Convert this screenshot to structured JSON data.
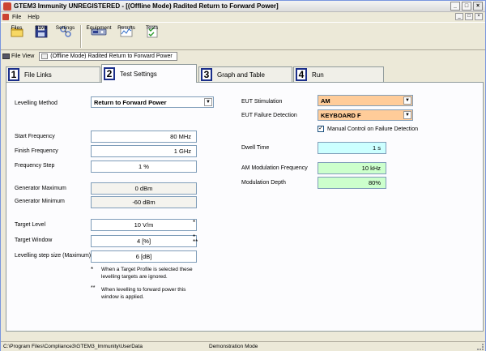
{
  "window": {
    "title": "GTEM3 Immunity UNREGISTERED - [(Offline Mode) Radited Return to Forward Power]",
    "buttons": [
      "_",
      "□",
      "×"
    ]
  },
  "menu": {
    "items": [
      {
        "label": "File"
      },
      {
        "label": "Help"
      }
    ]
  },
  "toolbar": {
    "files": "Files",
    "save": "Save",
    "settings": "Settings",
    "equipment": "Equipment",
    "results": "Results",
    "tests": "Tests"
  },
  "docbar": {
    "file_view": "File View",
    "doc_tab": "(Offline Mode) Radited Return to Forward Power"
  },
  "tabs": [
    {
      "num": "1",
      "label": "File Links"
    },
    {
      "num": "2",
      "label": "Test Settings"
    },
    {
      "num": "3",
      "label": "Graph and Table"
    },
    {
      "num": "4",
      "label": "Run"
    }
  ],
  "left": {
    "levelling_method": {
      "label": "Levelling Method",
      "value": "Return to Forward Power"
    },
    "start_frequency": {
      "label": "Start Frequency",
      "value": "80 MHz"
    },
    "finish_frequency": {
      "label": "Finish Frequency",
      "value": "1 GHz"
    },
    "frequency_step": {
      "label": "Frequency Step",
      "value": "1 %"
    },
    "generator_maximum": {
      "label": "Generator Maximum",
      "value": "0 dBm"
    },
    "generator_minimum": {
      "label": "Generator Minimum",
      "value": "-60 dBm"
    },
    "target_level": {
      "label": "Target Level",
      "value": "10 V/m",
      "mark": "*"
    },
    "target_window": {
      "label": "Target Window",
      "value": "4 [%]",
      "mark": "*\n**"
    },
    "levelling_step": {
      "label": "Levelling step size (Maximum)",
      "value": "6 [dB]"
    },
    "note1": {
      "mark": "*",
      "text": "When a Target Profile is selected these\nlevelling targets are ignored."
    },
    "note2": {
      "mark": "**",
      "text": "When levelling to forward power this\nwindow is applied."
    }
  },
  "right": {
    "eut_stimulation": {
      "label": "EUT Stimulation",
      "value": "AM"
    },
    "eut_failure_detection": {
      "label": "EUT Failure Detection",
      "value": "KEYBOARD F"
    },
    "manual_control": {
      "label": "Manual Control on Failure Detection",
      "checked": "✓"
    },
    "dwell_time": {
      "label": "Dwell Time",
      "value": "1 s"
    },
    "am_mod_freq": {
      "label": "AM Modulation Frequency",
      "value": "10 kHz"
    },
    "mod_depth": {
      "label": "Modulation Depth",
      "value": "80%"
    }
  },
  "status": {
    "path": "C:\\Program Files\\Compliance3\\GTEM3_Immunity\\UserData",
    "mode": "Demonstration Mode"
  },
  "colors": {
    "accent": "#1b2f8a",
    "orange_field": "#ffcc99",
    "cyan_field": "#ccffff",
    "green_field": "#ccffcc"
  }
}
